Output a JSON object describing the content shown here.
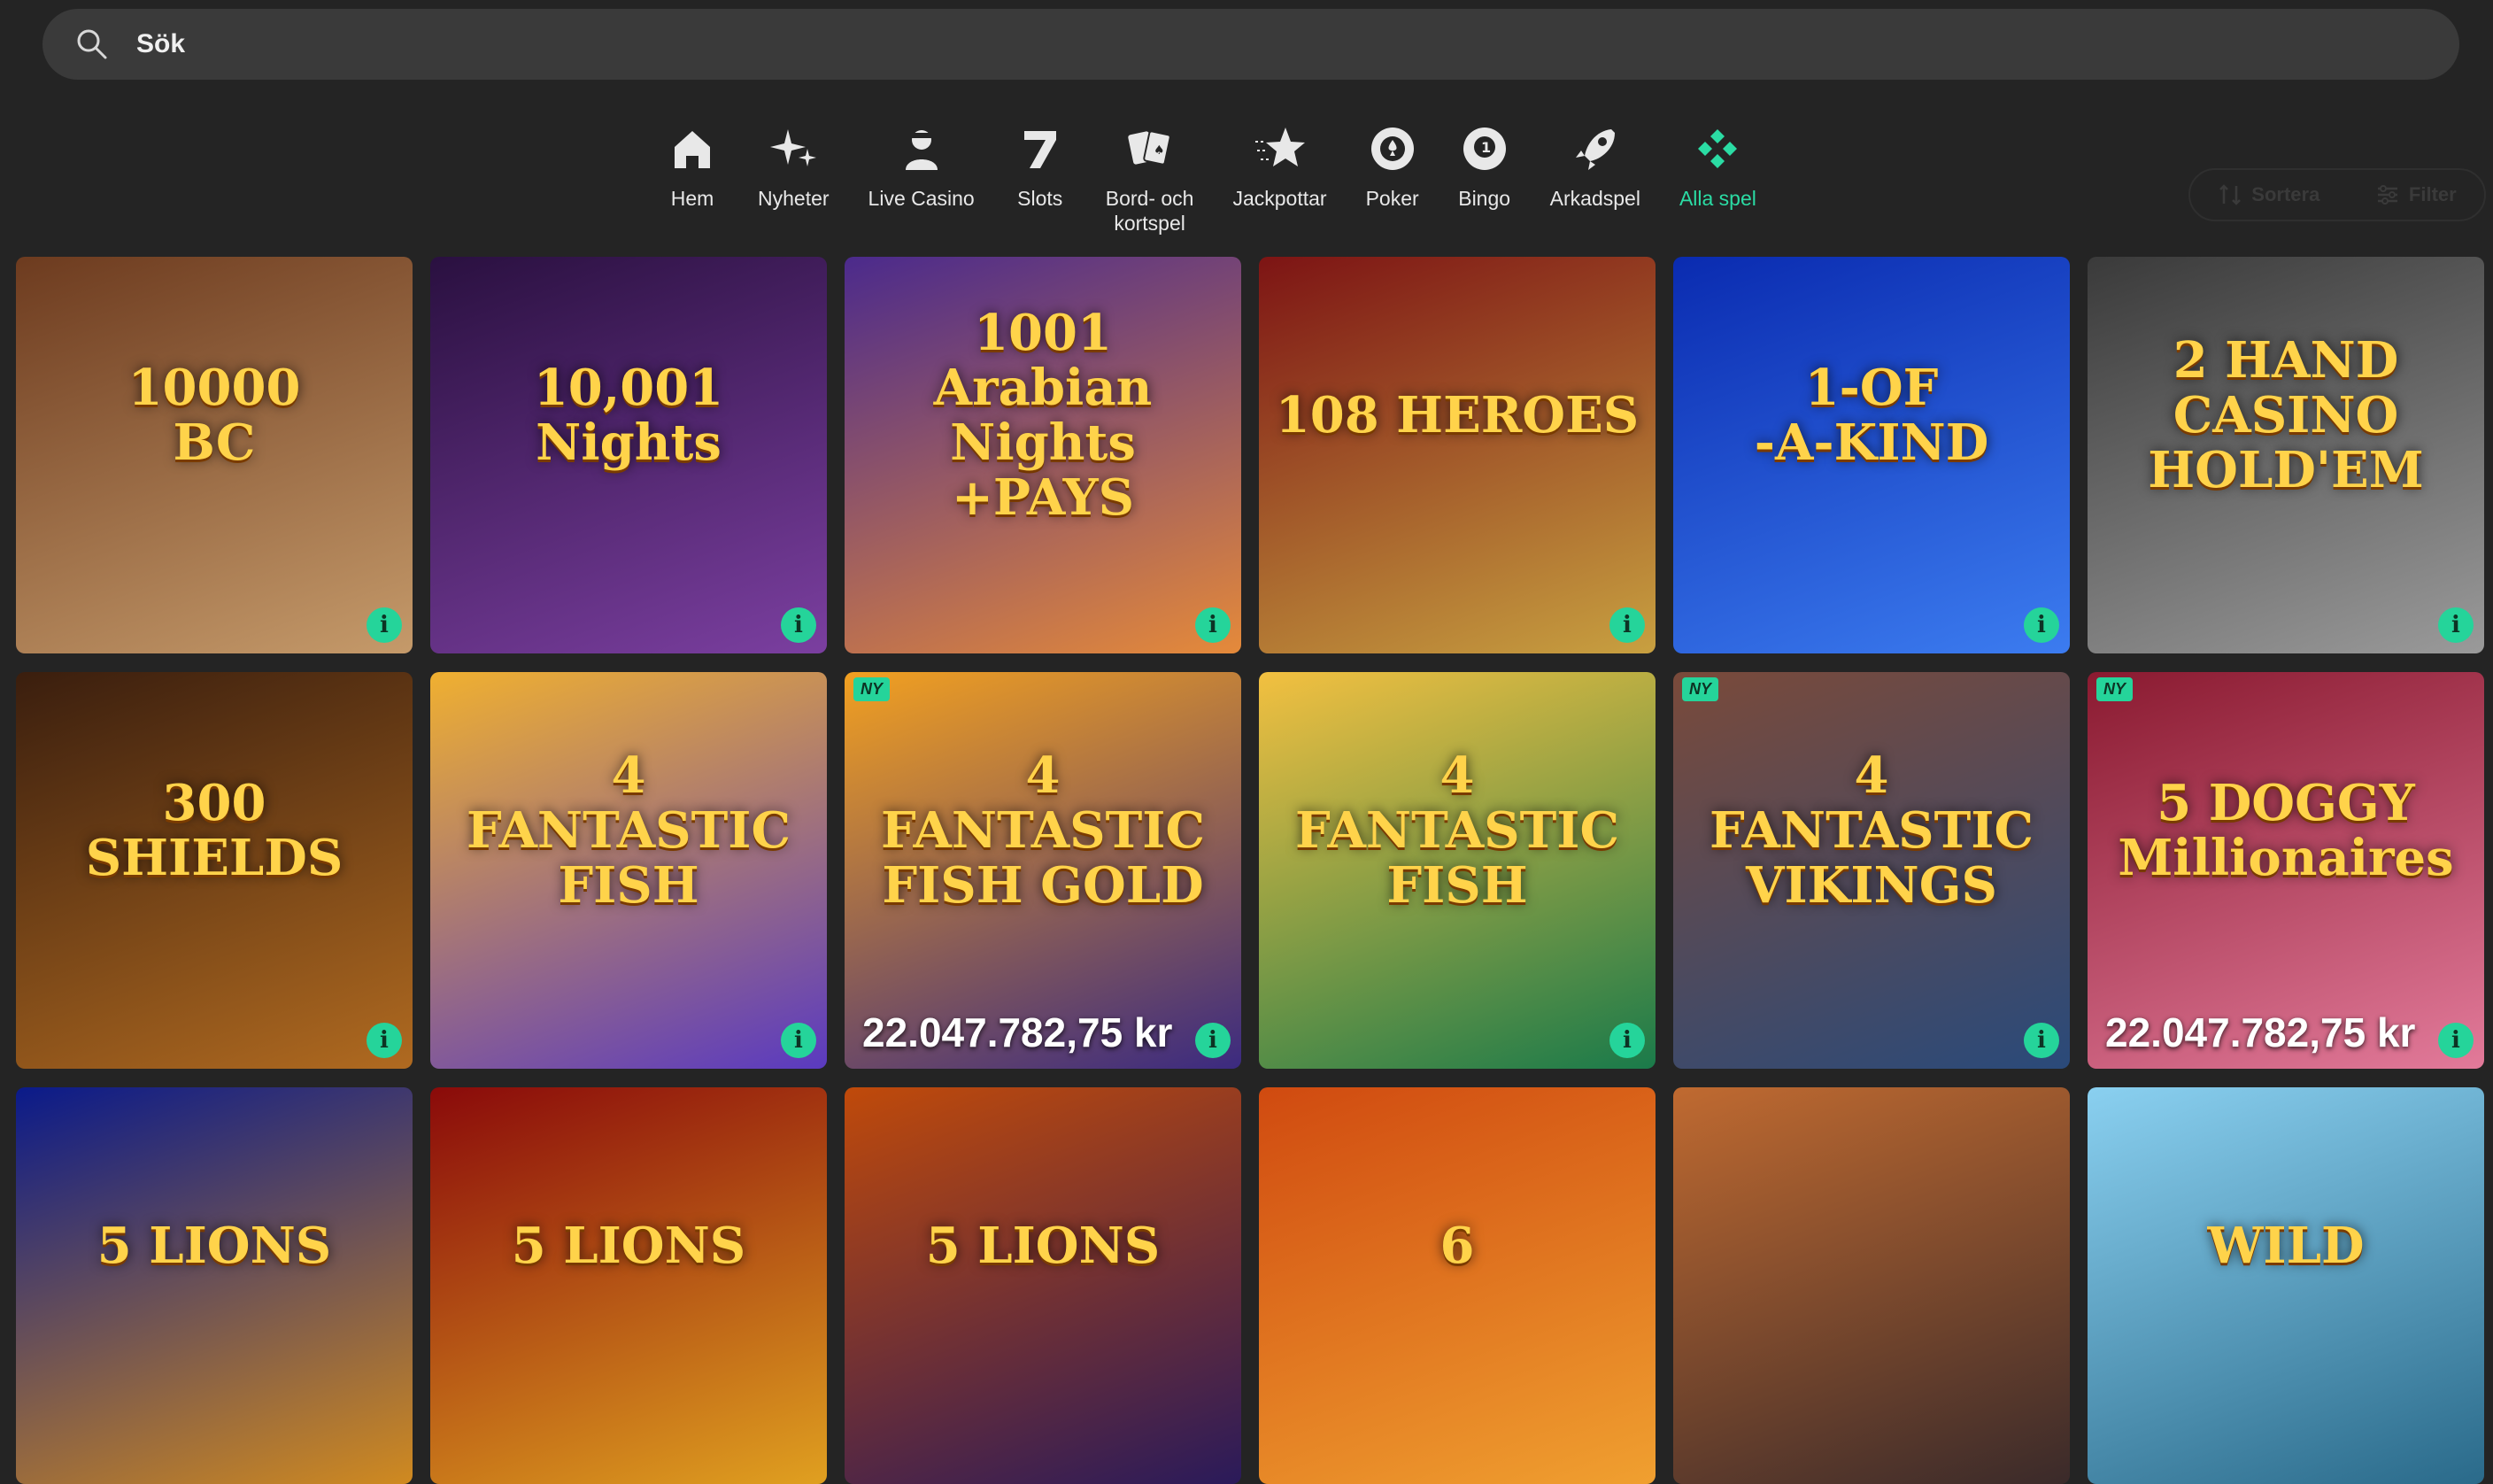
{
  "search": {
    "placeholder": "Sök"
  },
  "nav": [
    {
      "label": "Hem",
      "icon": "home-icon"
    },
    {
      "label": "Nyheter",
      "icon": "sparkles-icon"
    },
    {
      "label": "Live Casino",
      "icon": "dealer-icon"
    },
    {
      "label": "Slots",
      "icon": "seven-icon"
    },
    {
      "label": "Bord- och\nkortspel",
      "icon": "cards-icon"
    },
    {
      "label": "Jackpottar",
      "icon": "star-icon"
    },
    {
      "label": "Poker",
      "icon": "poker-chip-icon"
    },
    {
      "label": "Bingo",
      "icon": "bingo-ball-icon"
    },
    {
      "label": "Arkadspel",
      "icon": "rocket-icon"
    },
    {
      "label": "Alla spel",
      "icon": "diamonds-icon",
      "active": true
    }
  ],
  "sort_label": "Sortera",
  "filter_label": "Filter",
  "accent": "#25d49a",
  "games": [
    {
      "title": "10000\nBC",
      "bg": [
        "#6d3b1f",
        "#c59a6a"
      ]
    },
    {
      "title": "10,001\nNights",
      "bg": [
        "#2a1040",
        "#7b3fa0"
      ]
    },
    {
      "title": "1001\nArabian\nNights\n+PAYS",
      "bg": [
        "#4b2a8c",
        "#e58a3a"
      ]
    },
    {
      "title": "108 HEROES",
      "bg": [
        "#7d1414",
        "#c8a040"
      ]
    },
    {
      "title": "1-OF\n-A-KIND",
      "bg": [
        "#0a2bb0",
        "#3c7cf0"
      ]
    },
    {
      "title": "2 HAND\nCASINO\nHOLD'EM",
      "bg": [
        "#3a3a3a",
        "#9a9a9a"
      ]
    },
    {
      "title": "300\nSHIELDS",
      "bg": [
        "#3a1e0e",
        "#b06a20"
      ]
    },
    {
      "title": "4 FANTASTIC\nFISH",
      "bg": [
        "#f0b030",
        "#5a3ac0"
      ]
    },
    {
      "title": "4 FANTASTIC\nFISH GOLD",
      "bg": [
        "#f2a020",
        "#3b2a80"
      ],
      "badge": "NY",
      "jackpot": "22.047.782,75 kr"
    },
    {
      "title": "4\nFANTASTIC\nFISH",
      "bg": [
        "#f3c040",
        "#1a7a4a"
      ]
    },
    {
      "title": "4 FANTASTIC\nVIKINGS",
      "bg": [
        "#7a4a3a",
        "#2a4a7a"
      ],
      "badge": "NY"
    },
    {
      "title": "5 DOGGY\nMillionaires",
      "bg": [
        "#8a1a30",
        "#e27a9a"
      ],
      "badge": "NY",
      "jackpot": "22.047.782,75 kr"
    },
    {
      "title": "5 LIONS",
      "bg": [
        "#0a1a8a",
        "#d08a20"
      ]
    },
    {
      "title": "5 LIONS",
      "bg": [
        "#8a0a0a",
        "#e0a020"
      ]
    },
    {
      "title": "5 LIONS",
      "bg": [
        "#c04a0a",
        "#2a1a5a"
      ]
    },
    {
      "title": "6",
      "bg": [
        "#d04a10",
        "#f0a030"
      ]
    },
    {
      "title": "",
      "bg": [
        "#c06a30",
        "#3a2a2a"
      ]
    },
    {
      "title": "WILD",
      "bg": [
        "#8ad0f0",
        "#2a6a8a"
      ]
    }
  ]
}
